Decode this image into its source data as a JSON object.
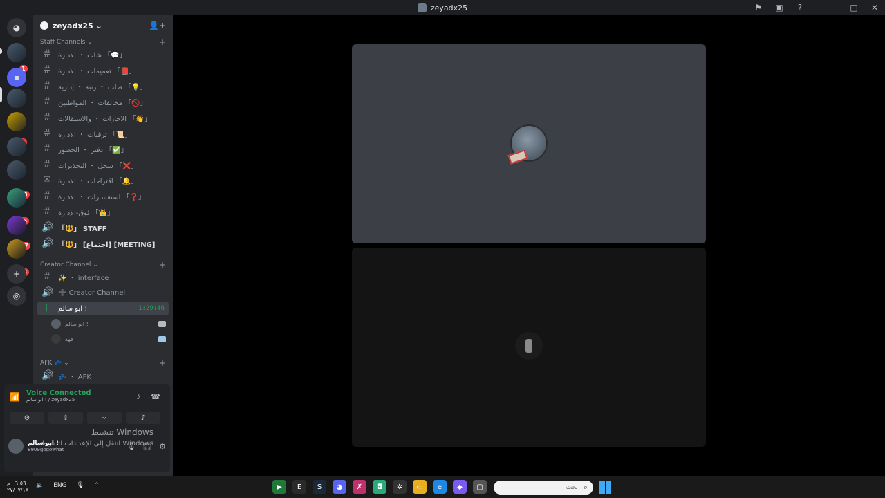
{
  "window": {
    "title": "zeyadx25"
  },
  "titlebar_icons": [
    "inbox-icon",
    "update-icon",
    "help-icon",
    "minimize-icon",
    "maximize-icon",
    "close-icon"
  ],
  "guild_badges": [
    "1",
    "2",
    "773",
    "25",
    "537",
    "23"
  ],
  "server": {
    "name": "zeyadx25 ⌄"
  },
  "categories": [
    {
      "label": "Staff Channels ⌄"
    },
    {
      "label": "Creator Channel ⌄"
    },
    {
      "label": "AFK 💤 ⌄"
    }
  ],
  "staff_channels": [
    {
      "name": "شات ・ الادارة 「💬」"
    },
    {
      "name": "تعميمات ・ الادارة 「📕」"
    },
    {
      "name": "طلب ・ رتبة ・ إدارية 「💡」"
    },
    {
      "name": "مخالفات ・ المواطنين 「🚫」"
    },
    {
      "name": "الاجازات ・ والاستقالات 「👋」"
    },
    {
      "name": "ترقيات ・ الادارة 「📜」"
    },
    {
      "name": "دفتر ・ الحضور 「✅」"
    },
    {
      "name": "سجل ・ التحذيرات 「❌」"
    },
    {
      "name": "اقتراحات ・ الادارة 「🔔」"
    },
    {
      "name": "استفسارات ・ الادارة 「❓」"
    },
    {
      "name": "لوق-الإدارة 「👑」"
    },
    {
      "name": "「🔱」 STAFF"
    },
    {
      "name": "「🔱」 [اجتماع] [MEETING]"
    }
  ],
  "creator_channels": [
    {
      "name": "✨ ・ interface"
    },
    {
      "name": "➕ Creator Channel"
    }
  ],
  "active_voice": {
    "name": "ابو سالم !",
    "timer": "1:29:46"
  },
  "voice_users": [
    {
      "name": "ابو سالم !"
    },
    {
      "name": "فهد"
    }
  ],
  "afk_channels": [
    {
      "name": "💤 ・ AFK"
    }
  ],
  "voice_panel": {
    "status": "Voice Connected",
    "detail": "ابو سالم ! / zeyadx25"
  },
  "user": {
    "name": "ابو سالم !",
    "status": "8909gogowhat"
  },
  "watermark": {
    "line1": "تنشيط Windows",
    "line2": "انتقل إلى الإعدادات لتنشيط Windows"
  },
  "taskbar": {
    "time": "٠٦:٥٦ م",
    "date": "٢٧/٠٧/١٨",
    "lang": "ENG",
    "search_placeholder": "بحث"
  }
}
